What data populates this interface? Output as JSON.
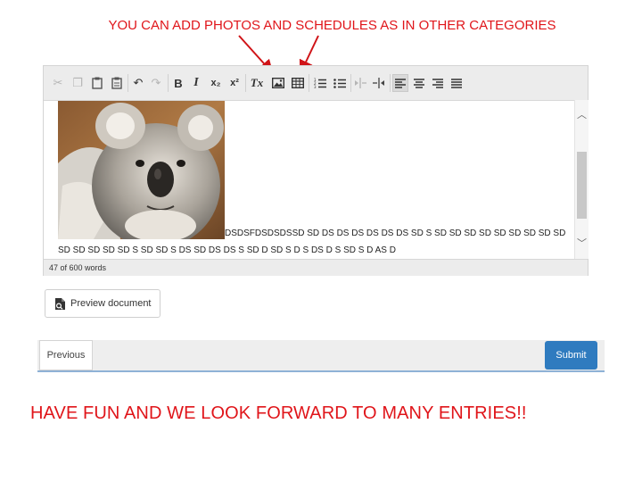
{
  "captions": {
    "top": "YOU CAN ADD PHOTOS AND SCHEDULES AS IN OTHER CATEGORIES",
    "bottom": "HAVE FUN AND WE LOOK FORWARD TO MANY ENTRIES!!"
  },
  "colors": {
    "caption_red": "#e0151a",
    "submit_blue": "#2f7bbf",
    "toolbar_bg": "#ececec"
  },
  "toolbar": {
    "icons": [
      "cut-icon",
      "copy-icon",
      "paste-icon",
      "paste-text-icon",
      "undo-icon",
      "redo-icon",
      "bold-icon",
      "italic-icon",
      "subscript-icon",
      "superscript-icon",
      "clear-format-icon",
      "image-icon",
      "table-icon",
      "numbered-list-icon",
      "bulleted-list-icon",
      "outdent-icon",
      "indent-icon",
      "align-left-icon",
      "align-center-icon",
      "align-right-icon",
      "justify-icon"
    ],
    "bold_label": "B",
    "italic_label": "I",
    "subscript_label": "x₂",
    "superscript_label": "x²",
    "clear_format_label": "Tx"
  },
  "editor": {
    "line1": "DSDSFDSDSDSSD SD DS DS DS DS DS DS SD S SD SD SD SD SD SD SD SD SD",
    "line2": "SD SD SD SD SD S SD SD S DS SD  DS DS S SD D  SD S D S DS D S  SD  S D AS D"
  },
  "status": {
    "word_count": "47 of 600 words"
  },
  "buttons": {
    "preview": "Preview document",
    "previous": "Previous",
    "submit": "Submit"
  }
}
